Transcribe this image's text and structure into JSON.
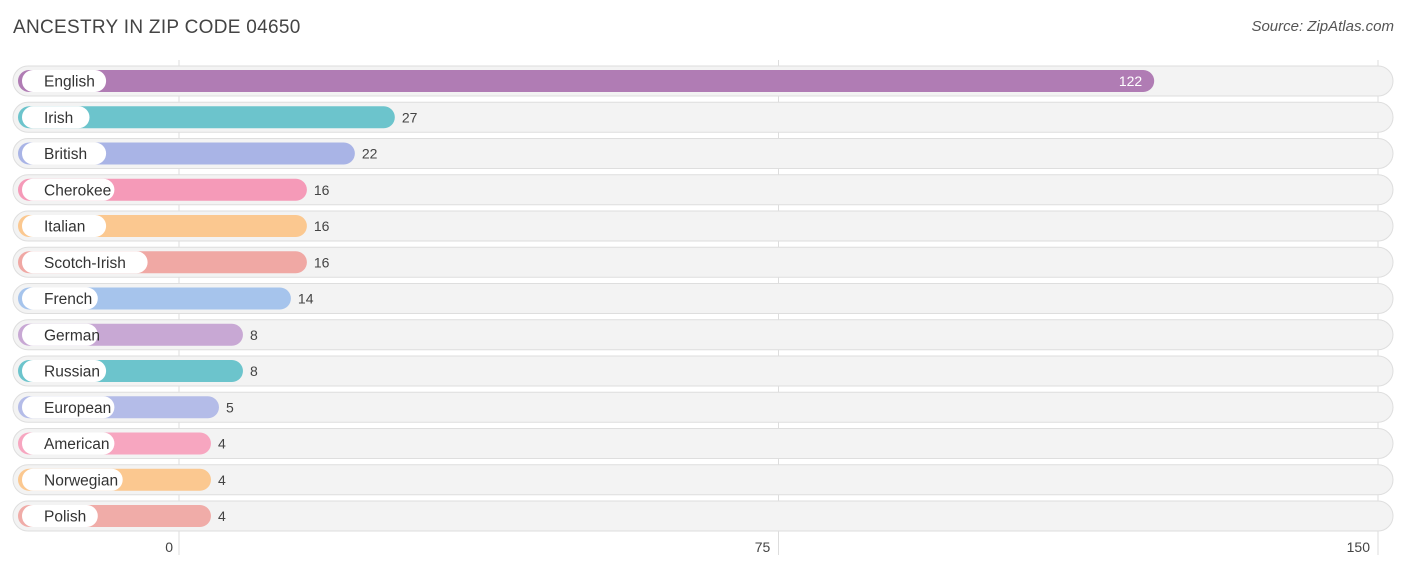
{
  "header": {
    "title": "ANCESTRY IN ZIP CODE 04650",
    "source": "Source: ZipAtlas.com"
  },
  "chart_data": {
    "type": "bar",
    "orientation": "horizontal",
    "title": "ANCESTRY IN ZIP CODE 04650",
    "xlabel": "",
    "ylabel": "",
    "xlim": [
      0,
      150
    ],
    "xticks": [
      0,
      75,
      150
    ],
    "grid": true,
    "legend": "none",
    "categories": [
      "English",
      "Irish",
      "British",
      "Cherokee",
      "Italian",
      "Scotch-Irish",
      "French",
      "German",
      "Russian",
      "European",
      "American",
      "Norwegian",
      "Polish"
    ],
    "values": [
      122,
      27,
      22,
      16,
      16,
      16,
      14,
      8,
      8,
      5,
      4,
      4,
      4
    ],
    "colors": [
      "#b07cb4",
      "#6cc4cc",
      "#a9b4e6",
      "#f59ab8",
      "#fbc890",
      "#f0a8a4",
      "#a6c4ec",
      "#c8a8d4",
      "#6cc4cc",
      "#b4bce8",
      "#f7a6c0",
      "#fbc890",
      "#f0aca8"
    ]
  }
}
